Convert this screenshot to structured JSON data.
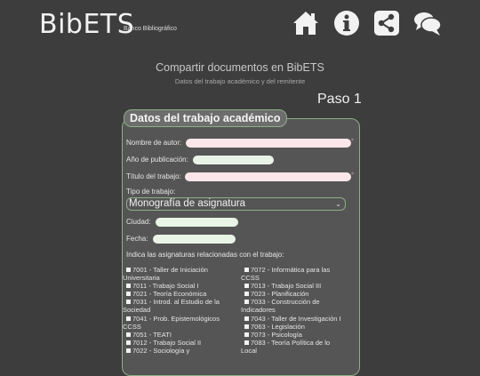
{
  "app": {
    "logo": "BibETS",
    "logo_sub": "Banco Bibliográfico"
  },
  "nav": [
    {
      "name": "home-icon"
    },
    {
      "name": "info-icon"
    },
    {
      "name": "share-icon"
    },
    {
      "name": "chat-icon"
    }
  ],
  "page": {
    "title": "Compartir documentos en BibETS",
    "subtitle": "Datos del trabajo académico y del remitente",
    "step": "Paso 1"
  },
  "form": {
    "legend": "Datos del trabajo académico",
    "author_label": "Nombre de autor:",
    "year_label": "Año de publicación:",
    "title_label": "Título del trabajo:",
    "type_label": "Tipo de trabajo:",
    "type_value": "Monografía de asignatura",
    "city_label": "Ciudad:",
    "date_label": "Fecha:",
    "subjects_label": "Indica las asignaturas relacionadas con el trabajo:",
    "required_mark": "*"
  },
  "subjects_left": [
    [
      "7001 - Taller de Iniciación",
      "Universitaria"
    ],
    [
      "7011 - Trabajo Social I"
    ],
    [
      "7021 - Teoría Económica"
    ],
    [
      "7031 - Introd. al Estudio de la",
      "Sociedad"
    ],
    [
      "7041 - Prob. Epistemológicos",
      "CCSS"
    ],
    [
      "7051 - TEATI"
    ],
    [
      "7012 - Trabajo Social II"
    ],
    [
      "7022 - Sociología y"
    ]
  ],
  "subjects_right": [
    [
      "7072 - Informática para las",
      "CCSS"
    ],
    [
      "7013 - Trabajo Social III"
    ],
    [
      "7023 - Planificación"
    ],
    [
      "7033 - Construcción de",
      "Indicadores"
    ],
    [
      "7043 - Taller de Investigación I"
    ],
    [
      "7063 - Legislación"
    ],
    [
      "7073 - Psicología"
    ],
    [
      "7083 - Teoría Política de lo",
      "Local"
    ]
  ]
}
